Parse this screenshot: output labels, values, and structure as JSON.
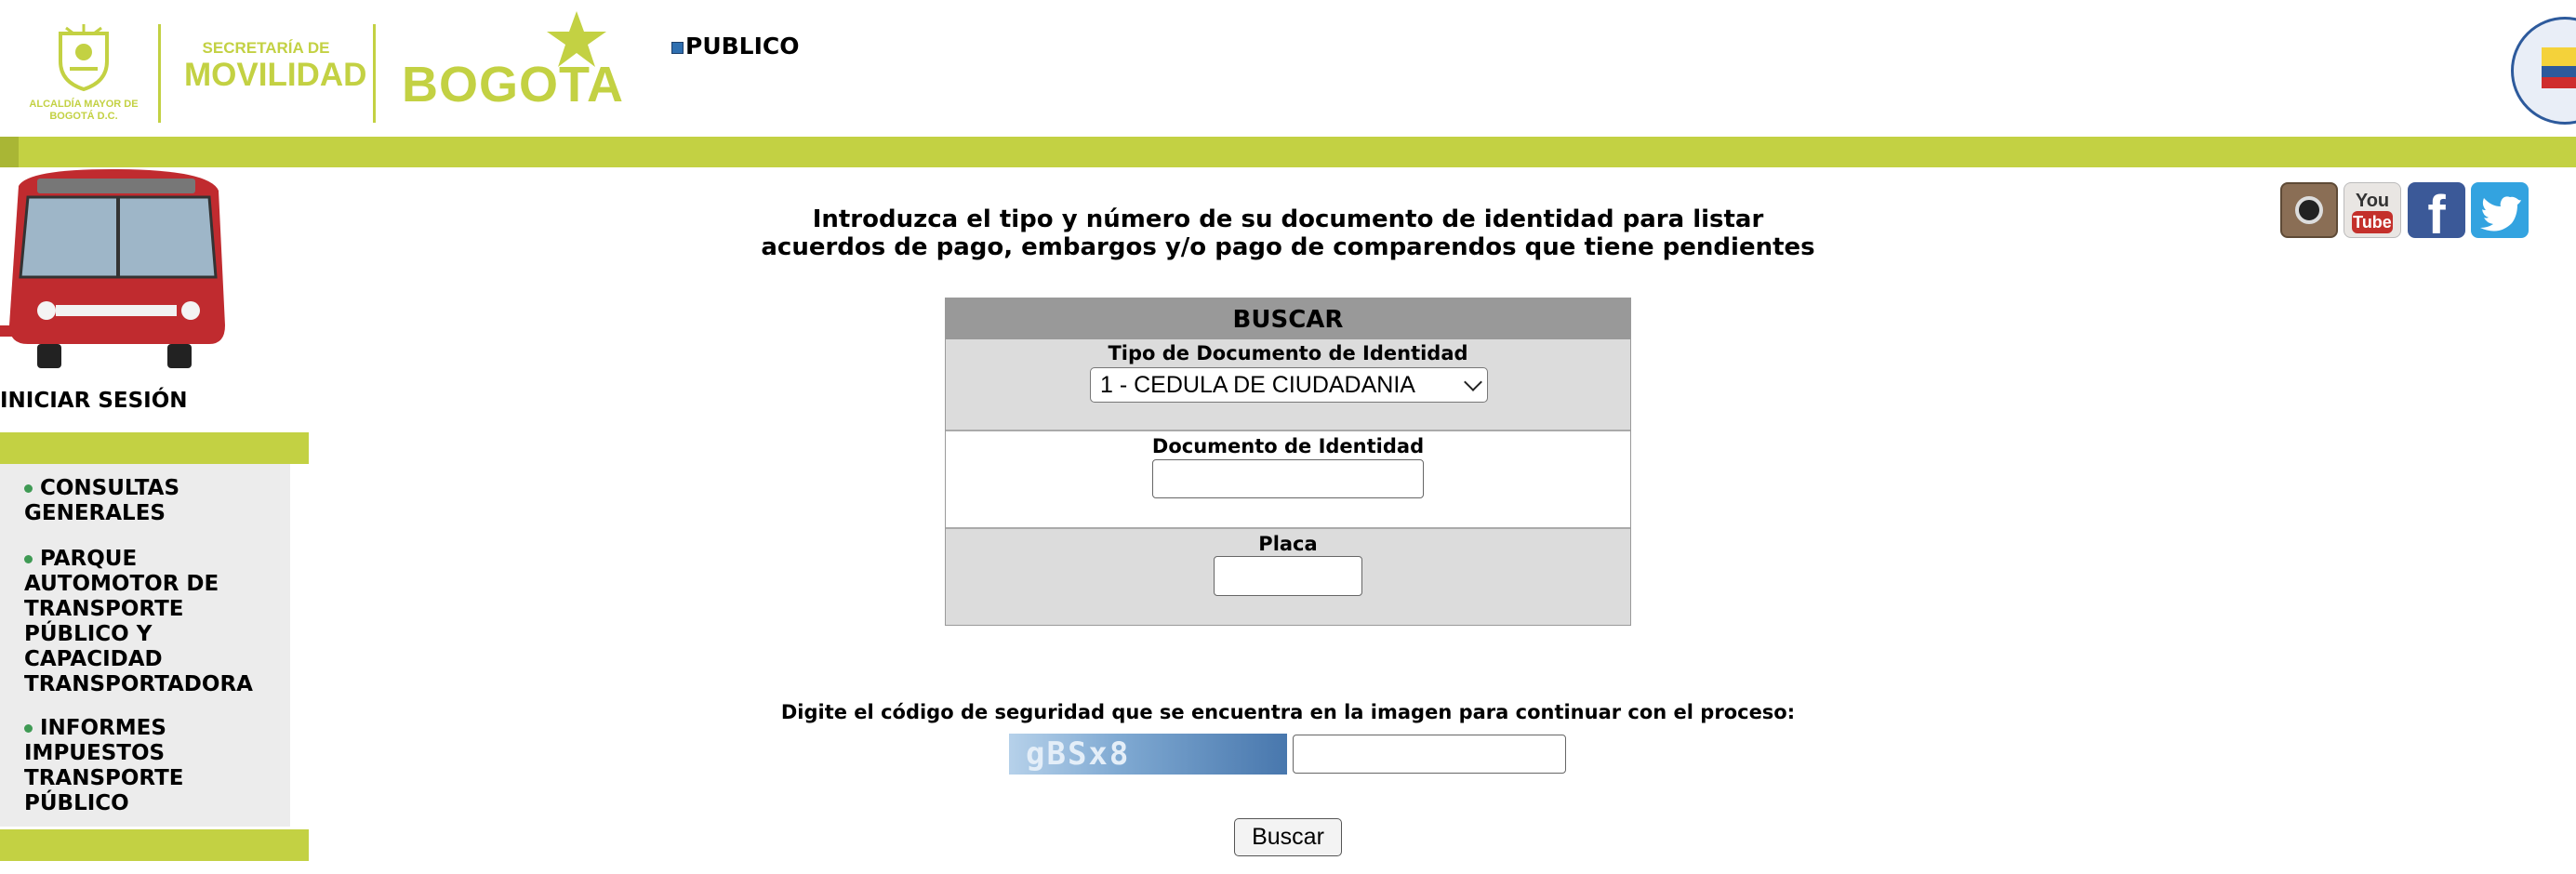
{
  "header": {
    "alcaldia_text": "ALCALDÍA MAYOR DE BOGOTÁ D.C.",
    "secretaria_small": "SECRETARÍA DE",
    "secretaria_big": "MOVILIDAD",
    "bogota_logo": "BOGOTA",
    "section_title": "PUBLICO",
    "brand_color": "#c3d143"
  },
  "sidebar": {
    "login_label": "INICIAR SESIÓN",
    "items": [
      {
        "label": "CONSULTAS GENERALES"
      },
      {
        "label": "PARQUE AUTOMOTOR DE TRANSPORTE PÚBLICO Y CAPACIDAD TRANSPORTADORA"
      },
      {
        "label": "INFORMES IMPUESTOS TRANSPORTE PÚBLICO"
      }
    ]
  },
  "social": {
    "icons": [
      "instagram-icon",
      "youtube-icon",
      "facebook-icon",
      "twitter-icon"
    ]
  },
  "main": {
    "intro_line1": "Introduzca el tipo y número de su documento de identidad para listar",
    "intro_line2": "acuerdos de pago, embargos y/o pago de comparendos que tiene pendientes",
    "search_title": "BUSCAR",
    "tipo_label": "Tipo de Documento de Identidad",
    "tipo_selected": "1 - CEDULA DE CIUDADANIA",
    "documento_label": "Documento de Identidad",
    "documento_value": "",
    "placa_label": "Placa",
    "placa_value": "",
    "captcha_prompt": "Digite el código de seguridad que se encuentra en la imagen para continuar con el proceso:",
    "captcha_code": "gBSx8",
    "captcha_value": "",
    "submit_label": "Buscar"
  }
}
